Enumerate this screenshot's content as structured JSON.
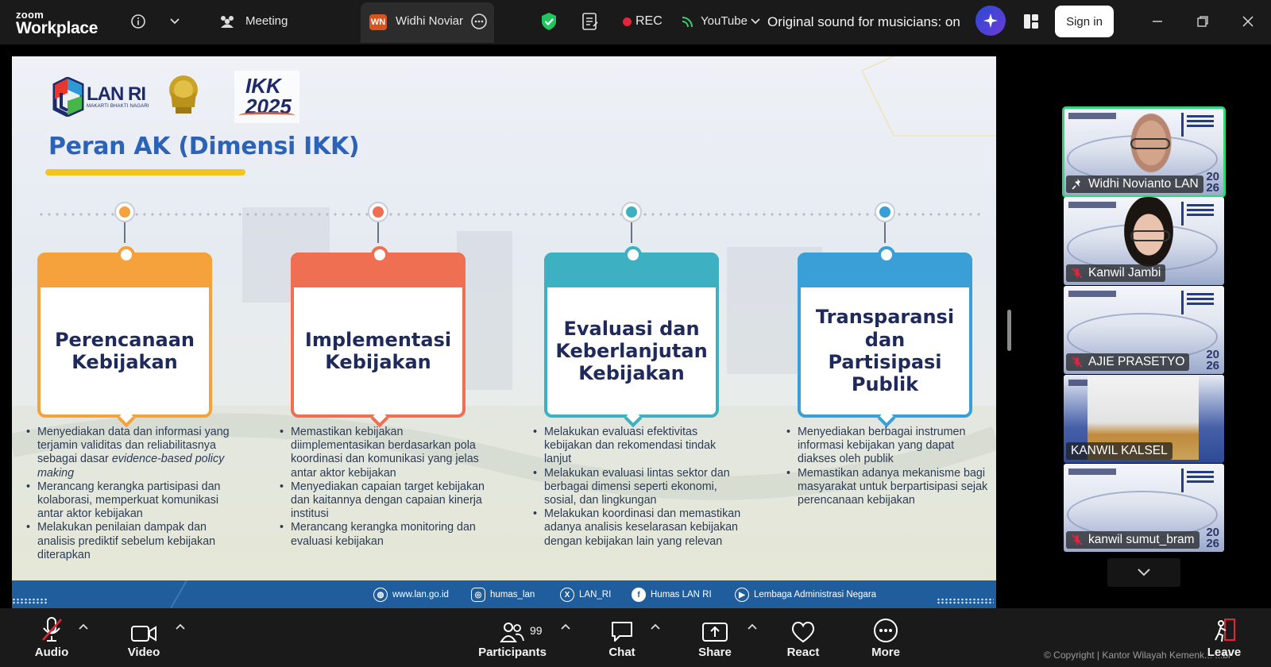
{
  "app": {
    "brand_top": "zoom",
    "brand_bottom": "Workplace",
    "meeting_tab_label": "Meeting",
    "active_tab_badge": "WN",
    "active_tab_label": "Widhi Noviar",
    "rec_label": "REC",
    "stream_label": "YouTube",
    "original_sound_label": "Original sound for musicians: on",
    "signin_label": "Sign in",
    "accent_green": "#2fd77a",
    "rec_red": "#e5243b"
  },
  "slide": {
    "logo_lan_text": "LAN RI",
    "logo_lan_tagline": "MAKARTI BHAKTI NAGARI",
    "ikk_line1": "IKK",
    "ikk_line2": "2025",
    "title": "Peran AK (Dimensi IKK)",
    "columns": [
      {
        "title": "Perencanaan Kebijakan",
        "color": "#f6a23c",
        "bullets": [
          "Menyediakan data dan informasi yang terjamin validitas dan reliabilitasnya sebagai dasar",
          "Merancang kerangka partisipasi dan kolaborasi, memperkuat komunikasi antar aktor kebijakan",
          "Melakukan penilaian dampak dan analisis prediktif sebelum kebijakan diterapkan"
        ],
        "bullet1_italic": "evidence-based policy making"
      },
      {
        "title": "Implementasi Kebijakan",
        "color": "#ee6f52",
        "bullets": [
          "Memastikan kebijakan diimplementasikan berdasarkan pola koordinasi dan komunikasi yang jelas antar aktor kebijakan",
          "Menyediakan capaian target kebijakan dan kaitannya dengan capaian kinerja institusi",
          "Merancang kerangka monitoring dan evaluasi kebijakan"
        ]
      },
      {
        "title": "Evaluasi dan Keberlanjutan Kebijakan",
        "color": "#3db1c1",
        "bullets": [
          "Melakukan evaluasi efektivitas kebijakan dan rekomendasi tindak lanjut",
          "Melakukan evaluasi lintas sektor dan berbagai dimensi seperti ekonomi, sosial, dan lingkungan",
          "Melakukan koordinasi dan memastikan adanya analisis keselarasan kebijakan dengan kebijakan lain yang relevan"
        ]
      },
      {
        "title": "Transparansi dan Partisipasi Publik",
        "color": "#3a9fd6",
        "bullets": [
          "Menyediakan berbagai instrumen informasi kebijakan yang dapat diakses oleh publik",
          "Memastikan adanya mekanisme bagi masyarakat untuk berpartisipasi sejak perencanaan kebijakan"
        ]
      }
    ],
    "footer": {
      "website": "www.lan.go.id",
      "instagram": "humas_lan",
      "x": "LAN_RI",
      "facebook": "Humas LAN RI",
      "youtube": "Lembaga Administrasi Negara"
    }
  },
  "gallery": {
    "participants": [
      {
        "name": "Widhi Novianto LAN",
        "muted": false,
        "active": true
      },
      {
        "name": "Kanwil Jambi",
        "muted": true,
        "active": false
      },
      {
        "name": "AJIE PRASETYO",
        "muted": true,
        "active": false
      },
      {
        "name": "KANWIL KALSEL",
        "muted": false,
        "active": false
      },
      {
        "name": "kanwil sumut_bram",
        "muted": true,
        "active": false
      }
    ],
    "year_top": "20",
    "year_bottom": "26"
  },
  "toolbar": {
    "audio_label": "Audio",
    "video_label": "Video",
    "participants_label": "Participants",
    "participants_count": "99",
    "chat_label": "Chat",
    "share_label": "Share",
    "react_label": "React",
    "more_label": "More",
    "leave_label": "Leave",
    "copyright": "© Copyright | Kantor Wilayah Kemenk... ...bi"
  }
}
